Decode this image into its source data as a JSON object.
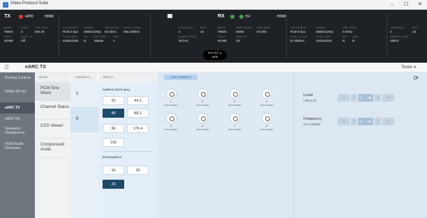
{
  "window": {
    "title": "Video Protocol Suite",
    "minimize": "–",
    "maximize": "☐",
    "close": "✕"
  },
  "tx": {
    "label": "TX",
    "hpd": "HPD",
    "interface": "HDMI",
    "lines": [
      {
        "lbl": "MODE",
        "val": "TMDS"
      },
      {
        "lbl": "LANE",
        "val": "3"
      },
      {
        "lbl": "LINK RATE",
        "val": "594.00"
      },
      {
        "lbl": "HDCP",
        "val": "NONE"
      },
      {
        "lbl": "LANE CK",
        "val": "Off"
      }
    ],
    "video": [
      {
        "lbl": "COLOR/BPC",
        "val": "RGB 8 bpc"
      },
      {
        "lbl": "TIMING",
        "val": "3840x2160p"
      },
      {
        "lbl": "VRR MODE",
        "val": "60.00Hz"
      },
      {
        "lbl": "PIXEL CLOCK",
        "val": "594.00MHz"
      },
      {
        "lbl": "TOTAL RES",
        "val": "4400x2250"
      },
      {
        "lbl": "VIC",
        "val": "N"
      },
      {
        "lbl": "PATTERN",
        "val": "Master"
      },
      {
        "lbl": "OSD",
        "val": "Y"
      }
    ],
    "audio": [
      {
        "lbl": "CHANNELS",
        "val": "2"
      },
      {
        "lbl": "BITS",
        "val": "16"
      },
      {
        "lbl": "SAMPLE RATE",
        "val": "48 kHz"
      }
    ]
  },
  "rx": {
    "label": "RX",
    "pwr": "5V",
    "interface": "HDMI",
    "lines": [
      {
        "lbl": "MODE",
        "val": "TMDS"
      },
      {
        "lbl": "TMDS MODE",
        "val": "HDMI"
      },
      {
        "lbl": "LINK RATE",
        "val": "67.500"
      },
      {
        "lbl": "HDCP",
        "val": "NONE"
      },
      {
        "lbl": "LANE CK",
        "val": "On"
      }
    ],
    "video": [
      {
        "lbl": "COLOR/BPC",
        "val": "RGB 8 bpc"
      },
      {
        "lbl": "TIMING",
        "val": "3840x2160p"
      },
      {
        "lbl": "VRR MODE",
        "val": "0.00Hz"
      },
      {
        "lbl": "PIXEL CLOCK",
        "val": "67.50MHz"
      },
      {
        "lbl": "TOTAL RES",
        "val": "4400x2250"
      },
      {
        "lbl": "VIC",
        "val": "N"
      },
      {
        "lbl": "OSD",
        "val": "N"
      }
    ],
    "audio": [
      {
        "lbl": "CHANNELS",
        "val": "2"
      },
      {
        "lbl": "BITS",
        "val": "16"
      },
      {
        "lbl": "SAMPLE RATE",
        "val": "48kHz"
      }
    ]
  },
  "aux_badge": {
    "line1": "AUX OUT ▲",
    "line2": "HIDE"
  },
  "toolbar": {
    "menu": "☰",
    "page": "eARC TX",
    "user": "Tester ▾"
  },
  "sidebar": {
    "items": [
      {
        "label": "Routing Controls",
        "active": false
      },
      {
        "label": "HDMI/ DP RX",
        "active": false
      },
      {
        "label": "eARC TX",
        "active": true
      },
      {
        "label": "eARC RX",
        "active": false
      },
      {
        "label": "Speakers/ Headphones",
        "active": false
      },
      {
        "label": "HDMI Audio Generator",
        "active": false
      }
    ]
  },
  "columns": {
    "mode": "MODE",
    "channels": "CHANNELS",
    "select": "SELECT"
  },
  "mode_items": [
    "PCM Sine Wave",
    "Channel Status",
    "CDS Viewer",
    "Compressed Audio"
  ],
  "channel_items": [
    "2",
    "8"
  ],
  "sample_rate": {
    "label": "SAMPLE RATE (kHz)",
    "options": [
      "32",
      "44.1",
      "48",
      "88.2",
      "96",
      "176.4",
      "192"
    ],
    "selected": "48"
  },
  "bits": {
    "label": "BITS/SAMPLE",
    "options": [
      "16",
      "20",
      "24"
    ],
    "selected": "24"
  },
  "link_channels": {
    "button": "LINK CHANNELS",
    "knobs": [
      {
        "num": "1",
        "val": "-48.00 1000Hz"
      },
      {
        "num": "2",
        "val": "-48.00 1000Hz"
      },
      {
        "num": "3",
        "val": "-48.00 1000Hz"
      },
      {
        "num": "4",
        "val": "-48.00 1000Hz"
      },
      {
        "num": "5",
        "val": "-48.00 1000Hz"
      },
      {
        "num": "6",
        "val": "-48.00 1000Hz"
      },
      {
        "num": "7",
        "val": "-48.00 1000Hz"
      },
      {
        "num": "8",
        "val": "-48.00 1000Hz"
      }
    ]
  },
  "controls": {
    "refresh": "⟳",
    "level": {
      "label": "Level",
      "range": "(-99 to 0)",
      "minus10": "-10",
      "minus1": "-1",
      "value": "0",
      "unit": "dB",
      "plus1": "+1",
      "plus10": "+10"
    },
    "frequency": {
      "label": "Frequency",
      "range": "(0 to 20000)",
      "minus10": "-10",
      "minus1": "-1",
      "value": "0",
      "unit": "Hz",
      "plus1": "+1",
      "plus10": "+10"
    }
  },
  "colors": {
    "status_bg": "#1e2126",
    "sidebar_bg": "#6f767d",
    "selected": "#1e4a6a",
    "tx_red": "#e53935",
    "rx_green": "#43a047"
  }
}
